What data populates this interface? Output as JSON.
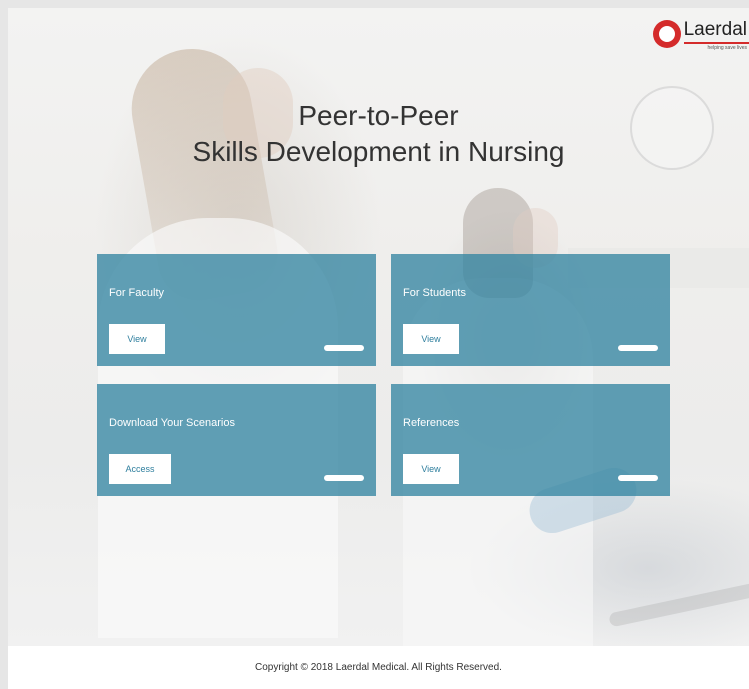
{
  "brand": {
    "name": "Laerdal",
    "tagline": "helping save lives",
    "accent": "#d42b2b"
  },
  "hero": {
    "title_line1": "Peer-to-Peer",
    "title_line2": "Skills Development in Nursing"
  },
  "cards": [
    {
      "label": "For Faculty",
      "button": "View"
    },
    {
      "label": "For Students",
      "button": "View"
    },
    {
      "label": "Download Your Scenarios",
      "button": "Access"
    },
    {
      "label": "References",
      "button": "View"
    }
  ],
  "colors": {
    "card_bg": "#3485a2",
    "button_text": "#2f7f9e"
  },
  "icons": {
    "logo": "laerdal-logo-icon"
  },
  "footer": {
    "copyright": "Copyright © 2018 Laerdal Medical. All Rights Reserved."
  }
}
